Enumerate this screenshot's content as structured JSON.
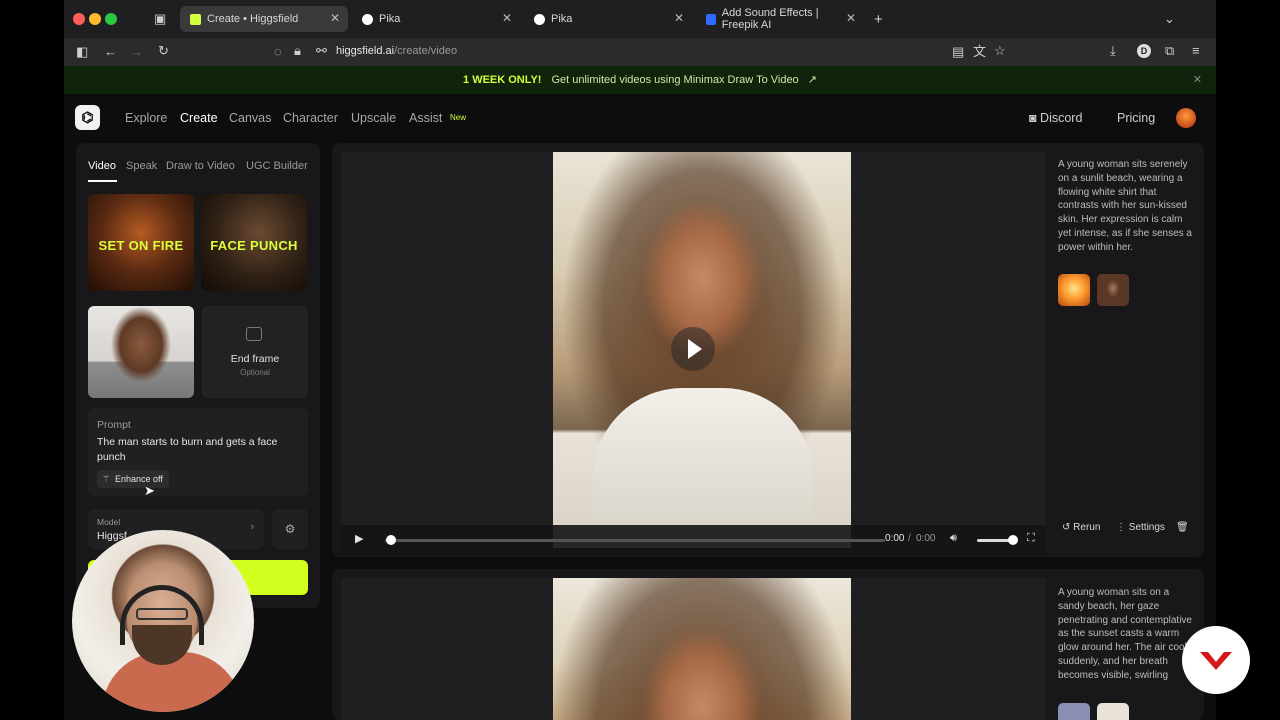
{
  "browser": {
    "tabs": [
      {
        "label": "Create • Higgsfield",
        "active": true,
        "favicon_color": "#d2ff3c"
      },
      {
        "label": "Pika",
        "active": false,
        "favicon_color": "#ffffff"
      },
      {
        "label": "Pika",
        "active": false,
        "favicon_color": "#ffffff"
      },
      {
        "label": "Add Sound Effects | Freepik AI",
        "active": false,
        "favicon_color": "#2f6bff"
      }
    ],
    "url_host": "higgsfield.ai",
    "url_path": "/create/video"
  },
  "banner": {
    "highlight": "1 WEEK ONLY!",
    "text": "Get unlimited videos using Minimax Draw To Video",
    "arrow": "↗"
  },
  "nav": {
    "logo": "⌬",
    "links": [
      "Explore",
      "Create",
      "Canvas",
      "Character",
      "Upscale",
      "Assist"
    ],
    "active": "Create",
    "new_badge": "New",
    "discord": "Discord",
    "pricing": "Pricing"
  },
  "left_panel": {
    "tabs": [
      "Video",
      "Speak",
      "Draw to Video",
      "UGC Builder"
    ],
    "active_tab": "Video",
    "presets": [
      "SET ON FIRE",
      "FACE PUNCH"
    ],
    "end_frame": {
      "label": "End frame",
      "sub": "Optional"
    },
    "prompt": {
      "title": "Prompt",
      "text": "The man starts to burn and gets a face punch",
      "enhance": "Enhance off"
    },
    "model": {
      "title": "Model",
      "value": "Higgsf"
    }
  },
  "cards": [
    {
      "description": "A young woman sits serenely on a sunlit beach, wearing a flowing white shirt that contrasts with her sun-kissed skin. Her expression is calm yet intense, as if she senses a power within her.",
      "time": "0:00",
      "duration": "0:00",
      "rerun": "Rerun",
      "settings": "Settings"
    },
    {
      "description": "A young woman sits on a sandy beach, her gaze penetrating and contemplative as the sunset casts a warm glow around her. The air cools suddenly, and her breath becomes visible, swirling"
    }
  ],
  "colors": {
    "accent": "#d2ff1e",
    "banner_bg": "#10230b",
    "panel": "#18181a"
  }
}
